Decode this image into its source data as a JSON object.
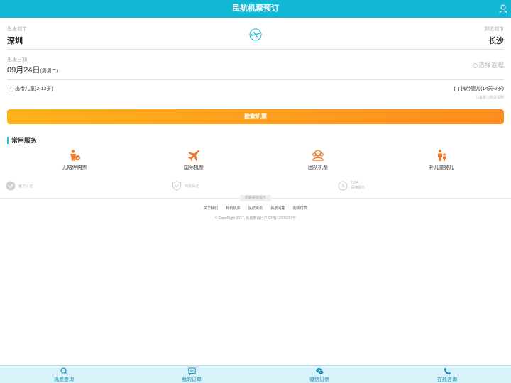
{
  "header": {
    "title": "民航机票预订",
    "user_icon": "user-icon"
  },
  "search": {
    "departure_label": "出发城市",
    "departure_city": "深圳",
    "arrival_label": "到达城市",
    "arrival_city": "长沙",
    "swap_icon": "plane-swap-icon",
    "date_label": "出发日期",
    "date": "09月24日",
    "weekday": "(周周二)",
    "round_trip": "选择返程",
    "with_child": "携带儿童(2-12岁)",
    "with_infant": "携带婴儿(14天-2岁)",
    "child_note": "儿童婴儿购票说明",
    "search_button": "搜索机票",
    "accent": "#13b7d6",
    "button_colors": [
      "#ffb31b",
      "#ff8c1f"
    ]
  },
  "services": {
    "title": "常用服务",
    "items": [
      {
        "label": "无陪伴购票",
        "icon": "unaccompanied-child-icon"
      },
      {
        "label": "国际机票",
        "icon": "plane-icon"
      },
      {
        "label": "团队机票",
        "icon": "group-icon"
      },
      {
        "label": "补儿童婴儿",
        "icon": "family-icon"
      }
    ],
    "icon_color": "#f07a2a"
  },
  "trust": [
    {
      "label": "官方认证",
      "icon": "verified-icon"
    },
    {
      "label": "出票保证",
      "icon": "shield-icon"
    },
    {
      "label": "7x24",
      "label2": "保障服务",
      "icon": "clock-icon"
    }
  ],
  "footer": {
    "divider_tag": "航路跳转提示",
    "links": [
      "关于我们",
      "特价机票",
      "民航资讯",
      "民航问答",
      "购票付款"
    ],
    "copyright": "© CopyRight 2017, 民航数出行沪ICP备12008257号"
  },
  "tabbar": [
    {
      "label": "机票查询",
      "icon": "search-icon"
    },
    {
      "label": "我的订单",
      "icon": "order-icon"
    },
    {
      "label": "微信订票",
      "icon": "wechat-icon"
    },
    {
      "label": "在线咨询",
      "icon": "phone-icon"
    }
  ]
}
